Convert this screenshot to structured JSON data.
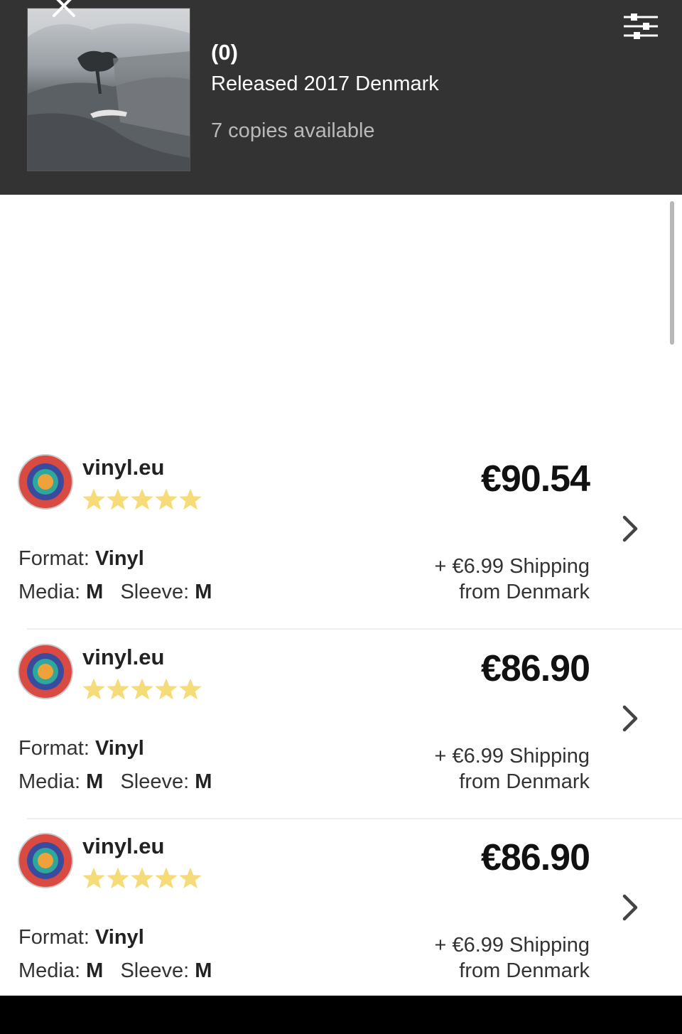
{
  "header": {
    "count": "(0)",
    "released": "Released 2017 Denmark",
    "copies": "7 copies available",
    "close_icon": "close-icon",
    "filter_icon": "sliders-icon",
    "background_color": "#333333"
  },
  "listings": [
    {
      "seller": "vinyl.eu",
      "rating_stars": 5,
      "price": "€90.54",
      "format_label": "Format:",
      "format_value": "Vinyl",
      "media_label": "Media:",
      "media_value": "M",
      "sleeve_label": "Sleeve:",
      "sleeve_value": "M",
      "shipping": "+ €6.99 Shipping",
      "ships_from": "from Denmark"
    },
    {
      "seller": "vinyl.eu",
      "rating_stars": 5,
      "price": "€86.90",
      "format_label": "Format:",
      "format_value": "Vinyl",
      "media_label": "Media:",
      "media_value": "M",
      "sleeve_label": "Sleeve:",
      "sleeve_value": "M",
      "shipping": "+ €6.99 Shipping",
      "ships_from": "from Denmark"
    },
    {
      "seller": "vinyl.eu",
      "rating_stars": 5,
      "price": "€86.90",
      "format_label": "Format:",
      "format_value": "Vinyl",
      "media_label": "Media:",
      "media_value": "M",
      "sleeve_label": "Sleeve:",
      "sleeve_value": "M",
      "shipping": "+ €6.99 Shipping",
      "ships_from": "from Denmark"
    }
  ],
  "colors": {
    "star": "#f6dc78",
    "avatar_outer": "#d94a43",
    "avatar_middle": "#3a4a9e",
    "avatar_inner": "#2ea89a",
    "avatar_center": "#f0a23a"
  }
}
